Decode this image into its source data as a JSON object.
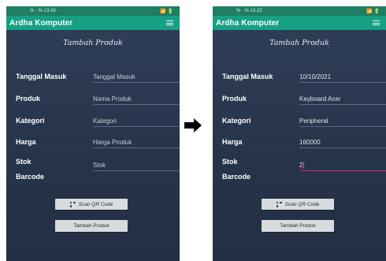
{
  "arrow_icon": "right-arrow",
  "screens": {
    "before": {
      "status_time": "% · % 13.43",
      "status_right": "📶 🔋",
      "app_title": "Ardha Komputer",
      "heading": "Tambah Produk",
      "fields": {
        "tanggal": {
          "label": "Tanggal Masuk",
          "value": "Tanggal Masuk"
        },
        "produk": {
          "label": "Produk",
          "value": "Nama Produk"
        },
        "kategori": {
          "label": "Kategori",
          "value": "Kategori"
        },
        "harga": {
          "label": "Harga",
          "value": "Harga Produk"
        },
        "stok": {
          "label": "Stok",
          "value": "Stok"
        },
        "barcode": {
          "label": "Barcode"
        }
      },
      "scan_button": "Scan QR Code",
      "submit_button": "Tambah Produk"
    },
    "after": {
      "status_time": "% · % 13.22",
      "status_right": "📶 🔋",
      "app_title": "Ardha Komputer",
      "heading": "Tambah Produk",
      "fields": {
        "tanggal": {
          "label": "Tanggal Masuk",
          "value": "10/10/2021"
        },
        "produk": {
          "label": "Produk",
          "value": "Keyboard Acer"
        },
        "kategori": {
          "label": "Kategori",
          "value": "Peripheral"
        },
        "harga": {
          "label": "Harga",
          "value": "160000"
        },
        "stok": {
          "label": "Stok",
          "value": "2"
        },
        "barcode": {
          "label": "Barcode"
        }
      },
      "scan_button": "Scan QR Code",
      "submit_button": "Tambah Produk"
    }
  },
  "colors": {
    "status_bar": "#1f7d63",
    "app_bar": "#16a085",
    "background": "#2a384f",
    "active_field": "#c42a7a",
    "button": "#d8dcde"
  }
}
